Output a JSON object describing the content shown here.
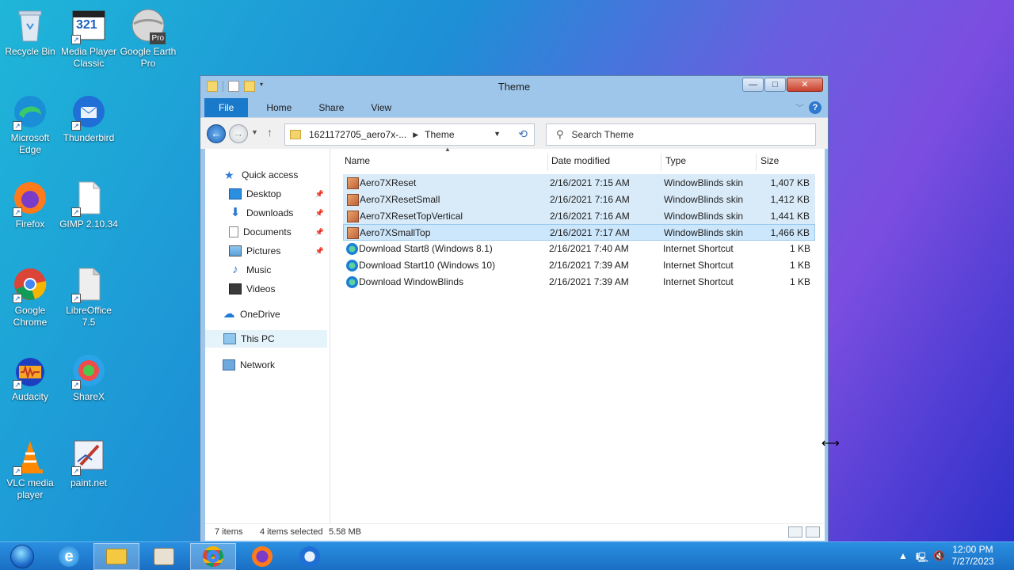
{
  "desktop": {
    "icons": [
      {
        "label": "Recycle Bin"
      },
      {
        "label": "Media Player Classic"
      },
      {
        "label": "Google Earth Pro"
      },
      {
        "label": "Microsoft Edge"
      },
      {
        "label": "Thunderbird"
      },
      {
        "label": "Firefox"
      },
      {
        "label": "GIMP 2.10.34"
      },
      {
        "label": "Google Chrome"
      },
      {
        "label": "LibreOffice 7.5"
      },
      {
        "label": "Audacity"
      },
      {
        "label": "ShareX"
      },
      {
        "label": "VLC media player"
      },
      {
        "label": "paint.net"
      }
    ],
    "media_player_badge": "321",
    "google_earth_badge": "Pro"
  },
  "window": {
    "title": "Theme",
    "ribbon_tabs": [
      "File",
      "Home",
      "Share",
      "View"
    ],
    "help_label": "?",
    "address": {
      "parent": "1621172705_aero7x-...",
      "current": "Theme"
    },
    "search_placeholder": "Search Theme",
    "nav_pane": {
      "quick_access": "Quick access",
      "items": [
        "Desktop",
        "Downloads",
        "Documents",
        "Pictures",
        "Music",
        "Videos"
      ],
      "onedrive": "OneDrive",
      "this_pc": "This PC",
      "network": "Network"
    },
    "columns": [
      "Name",
      "Date modified",
      "Type",
      "Size"
    ],
    "files": [
      {
        "name": "Aero7XReset",
        "date": "2/16/2021 7:15 AM",
        "type": "WindowBlinds skin",
        "size": "1,407 KB",
        "selected": true,
        "icon": "skin-icon"
      },
      {
        "name": "Aero7XResetSmall",
        "date": "2/16/2021 7:16 AM",
        "type": "WindowBlinds skin",
        "size": "1,412 KB",
        "selected": true,
        "icon": "skin-icon"
      },
      {
        "name": "Aero7XResetTopVertical",
        "date": "2/16/2021 7:16 AM",
        "type": "WindowBlinds skin",
        "size": "1,441 KB",
        "selected": true,
        "icon": "skin-icon"
      },
      {
        "name": "Aero7XSmallTop",
        "date": "2/16/2021 7:17 AM",
        "type": "WindowBlinds skin",
        "size": "1,466 KB",
        "selected": true,
        "icon": "skin-icon"
      },
      {
        "name": "Download Start8 (Windows 8.1)",
        "date": "2/16/2021 7:40 AM",
        "type": "Internet Shortcut",
        "size": "1 KB",
        "selected": false,
        "icon": "internet-shortcut-icon"
      },
      {
        "name": "Download Start10 (Windows 10)",
        "date": "2/16/2021 7:39 AM",
        "type": "Internet Shortcut",
        "size": "1 KB",
        "selected": false,
        "icon": "internet-shortcut-icon"
      },
      {
        "name": "Download WindowBlinds",
        "date": "2/16/2021 7:39 AM",
        "type": "Internet Shortcut",
        "size": "1 KB",
        "selected": false,
        "icon": "internet-shortcut-icon"
      }
    ],
    "status": {
      "items": "7 items",
      "selected": "4 items selected",
      "size": "5.58 MB"
    }
  },
  "taskbar": {
    "clock_time": "12:00 PM",
    "clock_date": "7/27/2023"
  }
}
